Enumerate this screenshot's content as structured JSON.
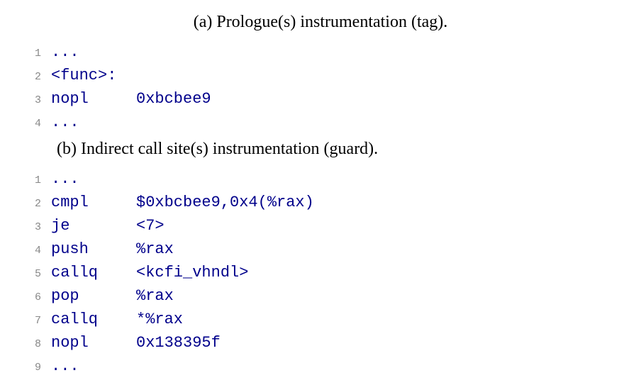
{
  "caption_a": "(a) Prologue(s) instrumentation (tag).",
  "caption_b": "(b) Indirect call site(s) instrumentation (guard).",
  "block_a": {
    "lines": [
      {
        "n": "1",
        "op": "...",
        "arg": ""
      },
      {
        "n": "2",
        "op": "<func>:",
        "arg": ""
      },
      {
        "n": "3",
        "op": "nopl",
        "arg": "0xbcbee9"
      },
      {
        "n": "4",
        "op": "...",
        "arg": ""
      }
    ]
  },
  "block_b": {
    "lines": [
      {
        "n": "1",
        "op": "...",
        "arg": ""
      },
      {
        "n": "2",
        "op": "cmpl",
        "arg": "$0xbcbee9,0x4(%rax)"
      },
      {
        "n": "3",
        "op": "je",
        "arg": "<7>"
      },
      {
        "n": "4",
        "op": "push",
        "arg": "%rax"
      },
      {
        "n": "5",
        "op": "callq",
        "arg": "<kcfi_vhndl>"
      },
      {
        "n": "6",
        "op": "pop",
        "arg": "%rax"
      },
      {
        "n": "7",
        "op": "callq",
        "arg": "*%rax"
      },
      {
        "n": "8",
        "op": "nopl",
        "arg": "0x138395f"
      },
      {
        "n": "9",
        "op": "...",
        "arg": ""
      }
    ]
  }
}
